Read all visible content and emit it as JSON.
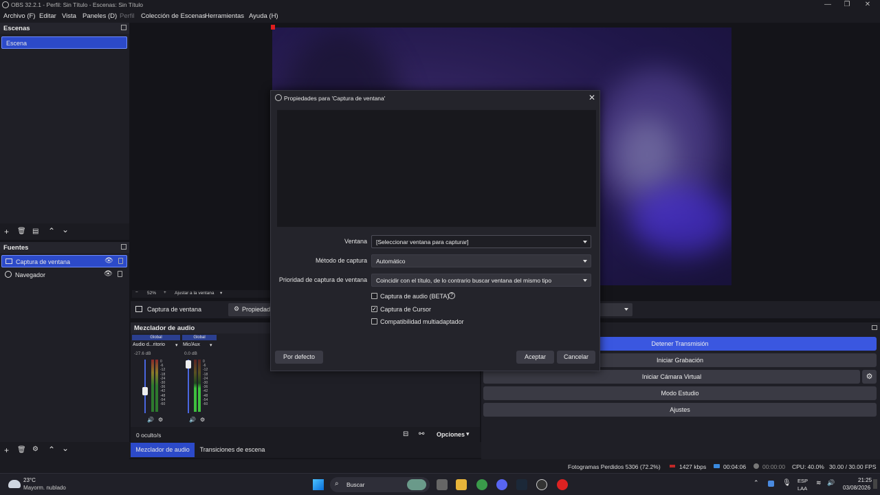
{
  "window": {
    "title": "OBS 32.2.1 - Perfil: Sin Título - Escenas: Sin Título",
    "controls": [
      "—",
      "❐",
      "✕"
    ]
  },
  "menu": [
    {
      "label": "Archivo (F)",
      "dim": false
    },
    {
      "label": "Editar",
      "dim": false
    },
    {
      "label": "Vista",
      "dim": false
    },
    {
      "label": "Paneles (D)",
      "dim": false
    },
    {
      "label": "Perfil",
      "dim": true
    },
    {
      "label": "Colección de Escenas",
      "dim": false
    },
    {
      "label": "Herramientas",
      "dim": false
    },
    {
      "label": "Ayuda (H)",
      "dim": false
    }
  ],
  "scenes": {
    "header": "Escenas",
    "items": [
      "Escena"
    ]
  },
  "sources": {
    "header": "Fuentes",
    "items": [
      {
        "label": "Captura de ventana",
        "selected": true
      },
      {
        "label": "Navegador",
        "selected": false
      }
    ]
  },
  "preview_bar": {
    "zoom": "52%",
    "fit": "Ajustar a la ventana"
  },
  "source_toolbar": {
    "name": "Captura de ventana",
    "properties": "Propiedad"
  },
  "mixer": {
    "header": "Mezclador de audio",
    "channels": [
      {
        "tag": "Global",
        "name": "Audio d...ritorio",
        "db": "-27.6 dB"
      },
      {
        "tag": "Global",
        "name": "Mic/Aux",
        "db": "0.0 dB"
      }
    ],
    "scale": [
      "0",
      "-6",
      "-12",
      "-18",
      "-24",
      "-30",
      "-36",
      "-42",
      "-48",
      "-54",
      "-60"
    ],
    "hidden": "0 oculto/s",
    "options": "Opciones"
  },
  "bottom_tabs": [
    "Mezclador de audio",
    "Transiciones de escena"
  ],
  "controls": {
    "buttons": [
      {
        "label": "Detener Transmisión",
        "active": true
      },
      {
        "label": "Iniciar Grabación",
        "active": false
      },
      {
        "label": "Iniciar Cámara Virtual",
        "active": false
      },
      {
        "label": "Modo Estudio",
        "active": false
      },
      {
        "label": "Ajustes",
        "active": false
      }
    ]
  },
  "dialog": {
    "title": "Propiedades para 'Captura de ventana'",
    "fields": [
      {
        "label": "Ventana",
        "value": "[Seleccionar ventana para capturar]"
      },
      {
        "label": "Método de captura",
        "value": "Automático"
      },
      {
        "label": "Prioridad de captura de ventana",
        "value": "Coincidir con el título, de lo contrario buscar ventana del mismo tipo"
      }
    ],
    "checkboxes": [
      {
        "label": "Captura de audio (BETA)",
        "checked": false
      },
      {
        "label": "Captura de Cursor",
        "checked": true
      },
      {
        "label": "Compatibilidad multiadaptador",
        "checked": false
      }
    ],
    "defaults_button": "Por defecto",
    "ok_button": "Aceptar",
    "cancel_button": "Cancelar"
  },
  "status": {
    "dropped": "Fotogramas Perdidos 5306 (72.2%)",
    "bitrate": "1427 kbps",
    "stream_time": "00:04:06",
    "rec_time": "00:00:00",
    "cpu": "CPU: 40.0%",
    "fps": "30.00 / 30.00 FPS"
  },
  "taskbar": {
    "weather_temp": "23°C",
    "weather_desc": "Mayorm. nublado",
    "search": "Buscar",
    "lang": "ESP",
    "lang2": "LAA",
    "time": "21:25",
    "date": "03/08/2026"
  },
  "colors": {
    "accent": "#3a57e0",
    "bg": "#1f1f26"
  }
}
